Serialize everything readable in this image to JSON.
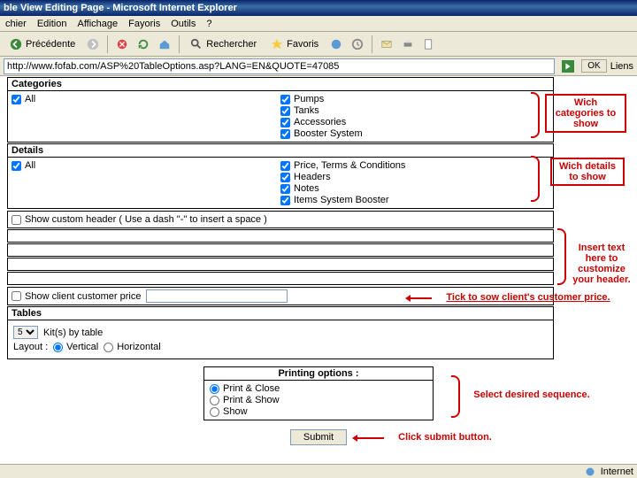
{
  "window": {
    "title": "ble View Editing Page - Microsoft Internet Explorer"
  },
  "menu": {
    "items": [
      "chier",
      "Edition",
      "Affichage",
      "Fayoris",
      "Outils",
      "?"
    ]
  },
  "toolbar": {
    "back": "Précédente",
    "search": "Rechercher",
    "favorites": "Favoris"
  },
  "address": {
    "url": "http://www.fofab.com/ASP%20TableOptions.asp?LANG=EN&QUOTE=47085",
    "ok": "OK",
    "links": "Liens"
  },
  "categories": {
    "title": "Categories",
    "all": "All",
    "items": [
      "Pumps",
      "Tanks",
      "Accessories",
      "Booster System"
    ]
  },
  "details": {
    "title": "Details",
    "all": "All",
    "items": [
      "Price, Terms & Conditions",
      "Headers",
      "Notes",
      "Items System Booster"
    ]
  },
  "custom": {
    "label": "Show custom header ( Use a dash \"-\" to insert a space )"
  },
  "price": {
    "label": "Show client customer price"
  },
  "tables": {
    "title": "Tables",
    "kits": "Kit(s) by table",
    "kitsval": "5",
    "layout": "Layout :",
    "vert": "Vertical",
    "horiz": "Horizontal"
  },
  "print": {
    "title": "Printing options :",
    "opts": [
      "Print & Close",
      "Print & Show",
      "Show"
    ]
  },
  "submit": "Submit",
  "callouts": {
    "cat": "Wich categories to show",
    "det": "Wich details to show",
    "hdr": "Insert text here to customize your header.",
    "price": "Tick to sow client's customer price.",
    "seq": "Select desired sequence.",
    "sub": "Click submit button."
  },
  "status": {
    "zone": "Internet"
  }
}
